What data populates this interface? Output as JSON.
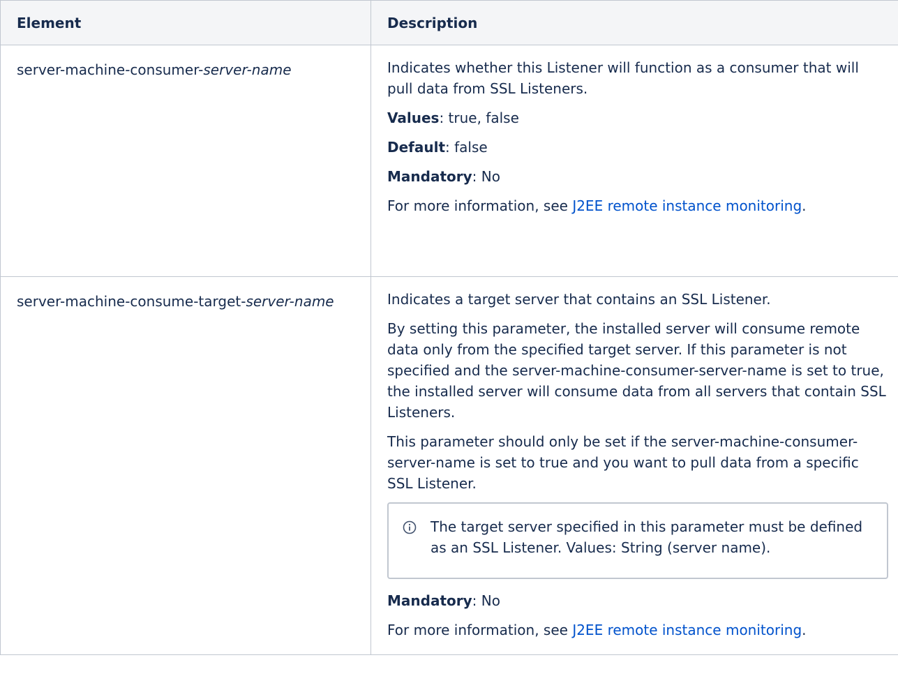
{
  "table": {
    "headers": {
      "element": "Element",
      "description": "Description"
    },
    "rows": [
      {
        "element_prefix": "server-machine-consumer-",
        "element_italic": "server-name",
        "desc": "Indicates whether this Listener will function as a consumer that will pull data from SSL Listeners.",
        "values_label": "Values",
        "values_text": ": true, false",
        "default_label": "Default",
        "default_text": ": false",
        "mandatory_label": "Mandatory",
        "mandatory_text": ": No",
        "info_prefix": "For more information, see ",
        "info_link": "J2EE remote instance monitoring",
        "info_suffix": "."
      },
      {
        "element_prefix": "server-machine-consume-target-",
        "element_italic": "server-name",
        "desc": "Indicates a target server that contains an SSL Listener.",
        "para2": "By setting this parameter, the installed server will consume remote data only from the specified target server. If this parameter is not specified and the server-machine-consumer-server-name is set to true, the installed server will consume data from all servers that contain SSL Listeners.",
        "para3": "This parameter should only be set if the server-machine-consumer-server-name is set to true and you want to pull data from a specific SSL Listener.",
        "note_icon": "info-icon",
        "note_text": "The target server specified in this parameter must be defined as an SSL Listener. Values: String (server name).",
        "mandatory_label": "Mandatory",
        "mandatory_text": ": No",
        "info_prefix": "For more information, see ",
        "info_link": "J2EE remote instance monitoring",
        "info_suffix": "."
      }
    ]
  },
  "colors": {
    "link": "#0052cc",
    "header_bg": "#f4f5f7",
    "border": "#c1c7d0",
    "text": "#172b4d"
  }
}
